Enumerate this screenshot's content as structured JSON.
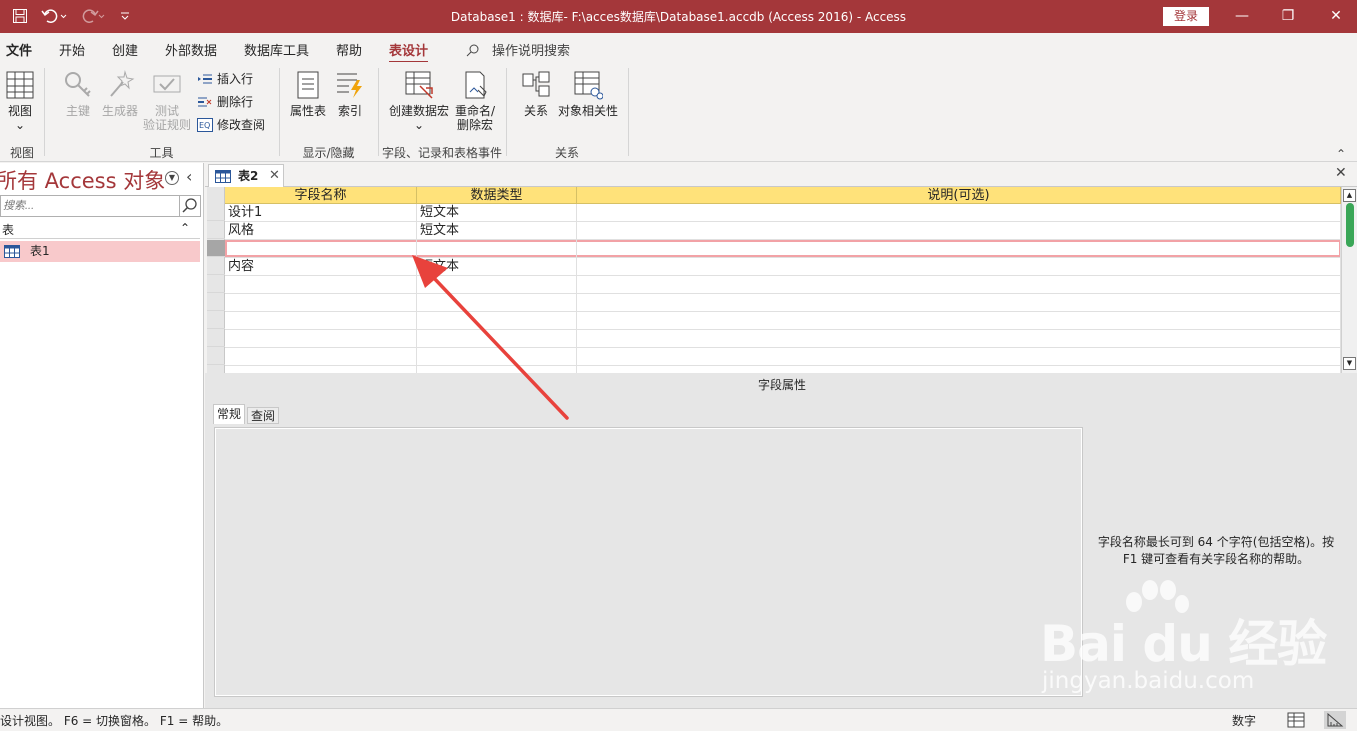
{
  "titlebar": {
    "title": "Database1 : 数据库- F:\\acces数据库\\Database1.accdb (Access 2016)  -  Access",
    "signin": "登录",
    "minimize_glyph": "—",
    "restore_glyph": "❐",
    "close_glyph": "✕"
  },
  "menu": {
    "items": [
      "文件",
      "开始",
      "创建",
      "外部数据",
      "数据库工具",
      "帮助",
      "表设计"
    ],
    "tellme": "操作说明搜索"
  },
  "ribbon": {
    "view": "视图",
    "view_arrow": "⌄",
    "primary_key": "主键",
    "builder": "生成器",
    "test_rules_1": "测试",
    "test_rules_2": "验证规则",
    "insert_rows": "插入行",
    "delete_rows": "删除行",
    "modify_lookups": "修改查阅",
    "property_sheet": "属性表",
    "indexes": "索引",
    "create_macro": "创建数据宏",
    "create_macro_arrow": "⌄",
    "rename_macro_1": "重命名/",
    "rename_macro_2": "删除宏",
    "relationships": "关系",
    "dependencies": "对象相关性",
    "groups": [
      "视图",
      "工具",
      "显示/隐藏",
      "字段、记录和表格事件",
      "关系"
    ],
    "collapse_glyph": "⌃"
  },
  "nav": {
    "title": "所有 Access 对象",
    "dropdown_glyph": "▼",
    "close_glyph": "‹",
    "search_placeholder": "搜索...",
    "section": "表",
    "section_chevron": "⌃",
    "items": [
      {
        "label": "表1"
      }
    ]
  },
  "document": {
    "tab": "表2",
    "tab_close": "✕",
    "close_glyph": "✕",
    "columns": [
      "字段名称",
      "数据类型",
      "说明(可选)"
    ],
    "rows": [
      {
        "name": "设计1",
        "type": "短文本",
        "desc": ""
      },
      {
        "name": "风格",
        "type": "短文本",
        "desc": ""
      },
      {
        "name": "",
        "type": "",
        "desc": ""
      },
      {
        "name": "内容",
        "type": "短文本",
        "desc": ""
      },
      {
        "name": "",
        "type": "",
        "desc": ""
      },
      {
        "name": "",
        "type": "",
        "desc": ""
      },
      {
        "name": "",
        "type": "",
        "desc": ""
      },
      {
        "name": "",
        "type": "",
        "desc": ""
      },
      {
        "name": "",
        "type": "",
        "desc": ""
      },
      {
        "name": "",
        "type": "",
        "desc": ""
      }
    ],
    "current_row": 2,
    "scroll_up": "▲",
    "scroll_down": "▼"
  },
  "field_properties": {
    "label": "字段属性",
    "tabs": [
      "常规",
      "查阅"
    ],
    "help": "字段名称最长可到 64 个字符(包括空格)。按 F1 键可查看有关字段名称的帮助。"
  },
  "watermark": {
    "logo": "Bai du 经验",
    "sub": "jingyan.baidu.com"
  },
  "statusbar": {
    "left": "设计视图。  F6 = 切换窗格。  F1 = 帮助。",
    "right": "数字"
  },
  "colors": {
    "accent": "#a4373a",
    "header": "#ffe27a",
    "selected_item": "#f8c9cb",
    "annotation_arrow": "#e8423c"
  }
}
